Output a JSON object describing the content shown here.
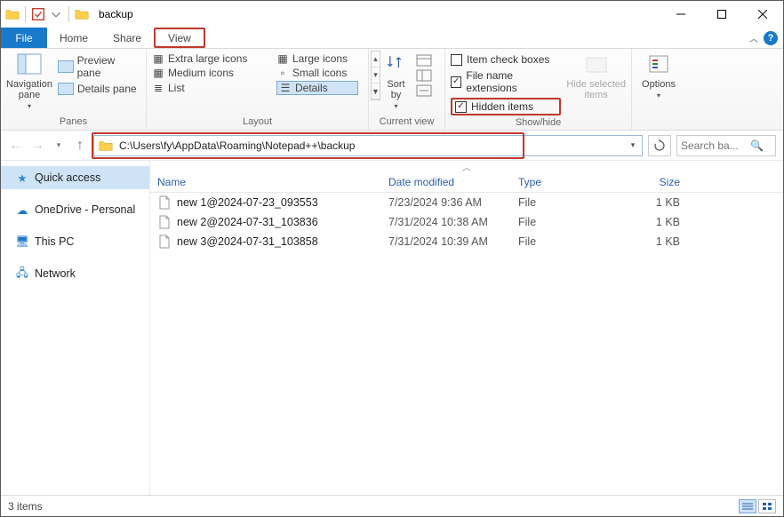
{
  "title": "backup",
  "tabs": {
    "file": "File",
    "home": "Home",
    "share": "Share",
    "view": "View"
  },
  "ribbon": {
    "panes": {
      "nav": "Navigation\npane",
      "preview": "Preview pane",
      "details": "Details pane",
      "group": "Panes"
    },
    "layout": {
      "xl": "Extra large icons",
      "lg": "Large icons",
      "md": "Medium icons",
      "sm": "Small icons",
      "list": "List",
      "details": "Details",
      "group": "Layout"
    },
    "current": {
      "sort": "Sort\nby",
      "group": "Current view"
    },
    "showhide": {
      "chk1": "Item check boxes",
      "chk2": "File name extensions",
      "chk3": "Hidden items",
      "hide": "Hide selected\nitems",
      "group": "Show/hide"
    },
    "options": "Options"
  },
  "address": {
    "path": "C:\\Users\\fy\\AppData\\Roaming\\Notepad++\\backup"
  },
  "search": {
    "placeholder": "Search ba..."
  },
  "sidebar": {
    "quick": "Quick access",
    "onedrive": "OneDrive - Personal",
    "thispc": "This PC",
    "network": "Network"
  },
  "columns": {
    "name": "Name",
    "date": "Date modified",
    "type": "Type",
    "size": "Size"
  },
  "files": [
    {
      "name": "new 1@2024-07-23_093553",
      "date": "7/23/2024 9:36 AM",
      "type": "File",
      "size": "1 KB"
    },
    {
      "name": "new 2@2024-07-31_103836",
      "date": "7/31/2024 10:38 AM",
      "type": "File",
      "size": "1 KB"
    },
    {
      "name": "new 3@2024-07-31_103858",
      "date": "7/31/2024 10:39 AM",
      "type": "File",
      "size": "1 KB"
    }
  ],
  "status": {
    "count": "3 items"
  }
}
